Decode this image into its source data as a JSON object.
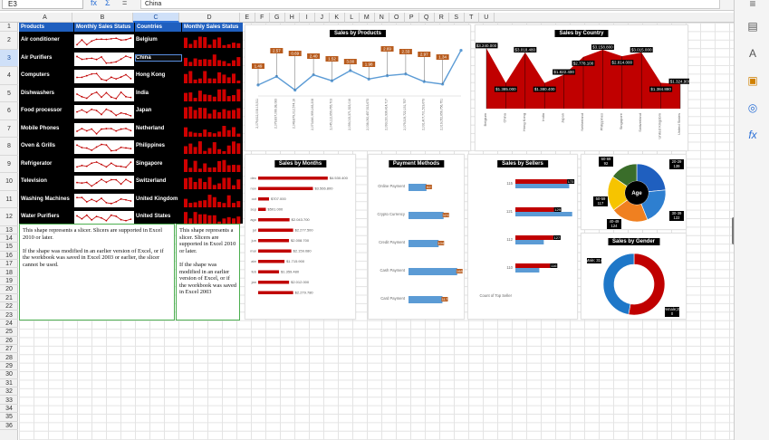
{
  "formula_bar": {
    "namebox": "E3",
    "func_icon": "fx",
    "sum_icon": "Σ",
    "equals_icon": "=",
    "value": "China"
  },
  "columns": [
    "A",
    "B",
    "C",
    "D",
    "E",
    "F",
    "G",
    "H",
    "I",
    "J",
    "K",
    "L",
    "M",
    "N",
    "O",
    "P",
    "Q",
    "R",
    "S",
    "T",
    "U"
  ],
  "selected_column": "C",
  "rows": [
    "1",
    "2",
    "3",
    "4",
    "5",
    "6",
    "7",
    "8",
    "9",
    "10",
    "11",
    "12",
    "13",
    "14",
    "15",
    "16",
    "17",
    "18",
    "19",
    "20",
    "21",
    "22",
    "23",
    "24",
    "25",
    "26",
    "27",
    "28",
    "29",
    "30",
    "31",
    "32",
    "33",
    "34",
    "35",
    "36"
  ],
  "selected_row": "3",
  "table": {
    "headers": [
      "Products",
      "Monthly Sales Status",
      "Countries",
      "Monthly Sales Status"
    ],
    "products": [
      "Air conditioner",
      "Air Purifiers",
      "Computers",
      "Dishwashers",
      "Food processor",
      "Mobile Phones",
      "Oven & Grills",
      "Refrigerator",
      "Television",
      "Washing Machines",
      "Water Purifiers"
    ],
    "countries": [
      "Belgium",
      "China",
      "Hong Kong",
      "India",
      "Japan",
      "Netherland",
      "Philippines",
      "Singapore",
      "Switzerland",
      "United Kingdom",
      "United States"
    ]
  },
  "slicers": {
    "left": [
      "This shape represents a slicer. Slicers are supported in Excel 2010 or later.",
      "If the shape was modified in an earlier version of Excel, or if the workbook was saved in Excel 2003 or earlier, the slicer cannot be used."
    ],
    "right": [
      "This shape represents a slicer. Slicers are supported in Excel 2010 or later.",
      "If the shape was modified in an earlier version of Excel, or if the workbook was saved in Excel 2003"
    ]
  },
  "chart_data": [
    {
      "type": "line",
      "title": "Sales by Products",
      "x": [
        "2,079,612,008.15,511",
        "2,079,837,066.38,083",
        "2,049,879,012,574.16",
        "2,073,640,959,163,208",
        "2,045,112,659,765,703",
        "2,059,015,371,523,016",
        "2,036,092,457,513,673",
        "2,093,020,936,414,717",
        "2,079,319,722,151,757",
        "2,031,407,701,519,673",
        "2,019,052,656,756,751",
        ""
      ],
      "values": [
        1.3,
        2.3,
        0.7,
        2.5,
        1.8,
        3.0,
        2.0,
        2.4,
        2.6,
        1.7,
        1.4,
        5.4
      ],
      "data_labels": [
        "1.49",
        "2.57",
        "0.69",
        "2.40",
        "1.52",
        "3.00",
        "1.98",
        "2.69",
        "2.33",
        "2.97",
        "1.34",
        ""
      ]
    },
    {
      "type": "area",
      "title": "Sales by Country",
      "categories": [
        "Belgium",
        "China",
        "Hong Kong",
        "India",
        "Japan",
        "Netherland",
        "Philippines",
        "Singapore",
        "Switzerland",
        "United Kingdom",
        "United States"
      ],
      "values": [
        3.24,
        1.385,
        3.018,
        1.38,
        1.822,
        2.778,
        3.158,
        2.814,
        3.015,
        1.384,
        1.324
      ],
      "data_labels": [
        "$3.240.000",
        "$1.385.000",
        "$3.018.480",
        "$1.380.400",
        "$1.822.400",
        "$2.778.100",
        "$3.158.800",
        "$2.814.000",
        "$3.015.000",
        "$1.384.880",
        "$1.324.900"
      ]
    },
    {
      "type": "bar",
      "title": "Sales by Months",
      "categories": [
        "dec",
        "nov",
        "oct",
        "sep",
        "ago",
        "jul",
        "jun",
        "mar",
        "abr",
        "feb",
        "jan"
      ],
      "values": [
        4.53,
        3.566,
        0.707,
        0.501,
        2.043,
        2.277,
        2.008,
        2.159,
        1.715,
        1.359,
        2.012,
        2.279
      ],
      "data_labels": [
        "$4.530.400",
        "$3.566.800",
        "$707.000",
        "$501.000",
        "$2.043.700",
        "$2.277.500",
        "$2.008.700",
        "$2.159.080",
        "$1.715.900",
        "$1.359.480",
        "$2.012.000",
        "$2.279.780"
      ]
    },
    {
      "type": "bar",
      "title": "Payment Methods",
      "categories": [
        "Online Payment",
        "Crypto Currency",
        "Credit Payment",
        "Cash Payment",
        "Card Payment"
      ],
      "values": [
        62,
        121,
        104,
        168,
        117
      ],
      "data_labels": [
        "62",
        "121",
        "104",
        "168",
        "117"
      ]
    },
    {
      "type": "bar",
      "title": "Sales by Sellers",
      "categories": [
        "115",
        "121",
        "112",
        "110",
        "Count of Top Seller"
      ],
      "series": [
        {
          "name": "",
          "values": [
            173,
            129,
            127,
            116
          ]
        },
        {
          "name": "",
          "values": [
            180,
            190,
            95,
            80
          ]
        }
      ],
      "data_labels": [
        "173",
        "129",
        "127",
        "116"
      ]
    },
    {
      "type": "pie",
      "title": "Age",
      "center_label": "Age",
      "categories": [
        "20-29",
        "30-39",
        "40-49",
        "50-59",
        "60-69"
      ],
      "values": [
        139,
        122,
        124,
        117,
        92
      ],
      "data_labels": [
        "20-29\n139",
        "30-39\n122",
        "40-49\n124",
        "50-59\n117",
        "60-69\n92"
      ],
      "colors": [
        "#1f5fbf",
        "#2e7fd0",
        "#f08020",
        "#f6c400",
        "#3a6d2a"
      ]
    },
    {
      "type": "pie",
      "title": "Sales by Gender",
      "categories": [
        "Male",
        "Female"
      ],
      "values": [
        314,
        280
      ],
      "data_labels": [
        "Male; 314",
        "Female;28\n0"
      ],
      "colors": [
        "#c00000",
        "#1e77c8"
      ]
    }
  ],
  "colors": {
    "header_blue": "#1f5fbf",
    "dark_red": "#b00000",
    "accent": "#2a6fd6"
  }
}
